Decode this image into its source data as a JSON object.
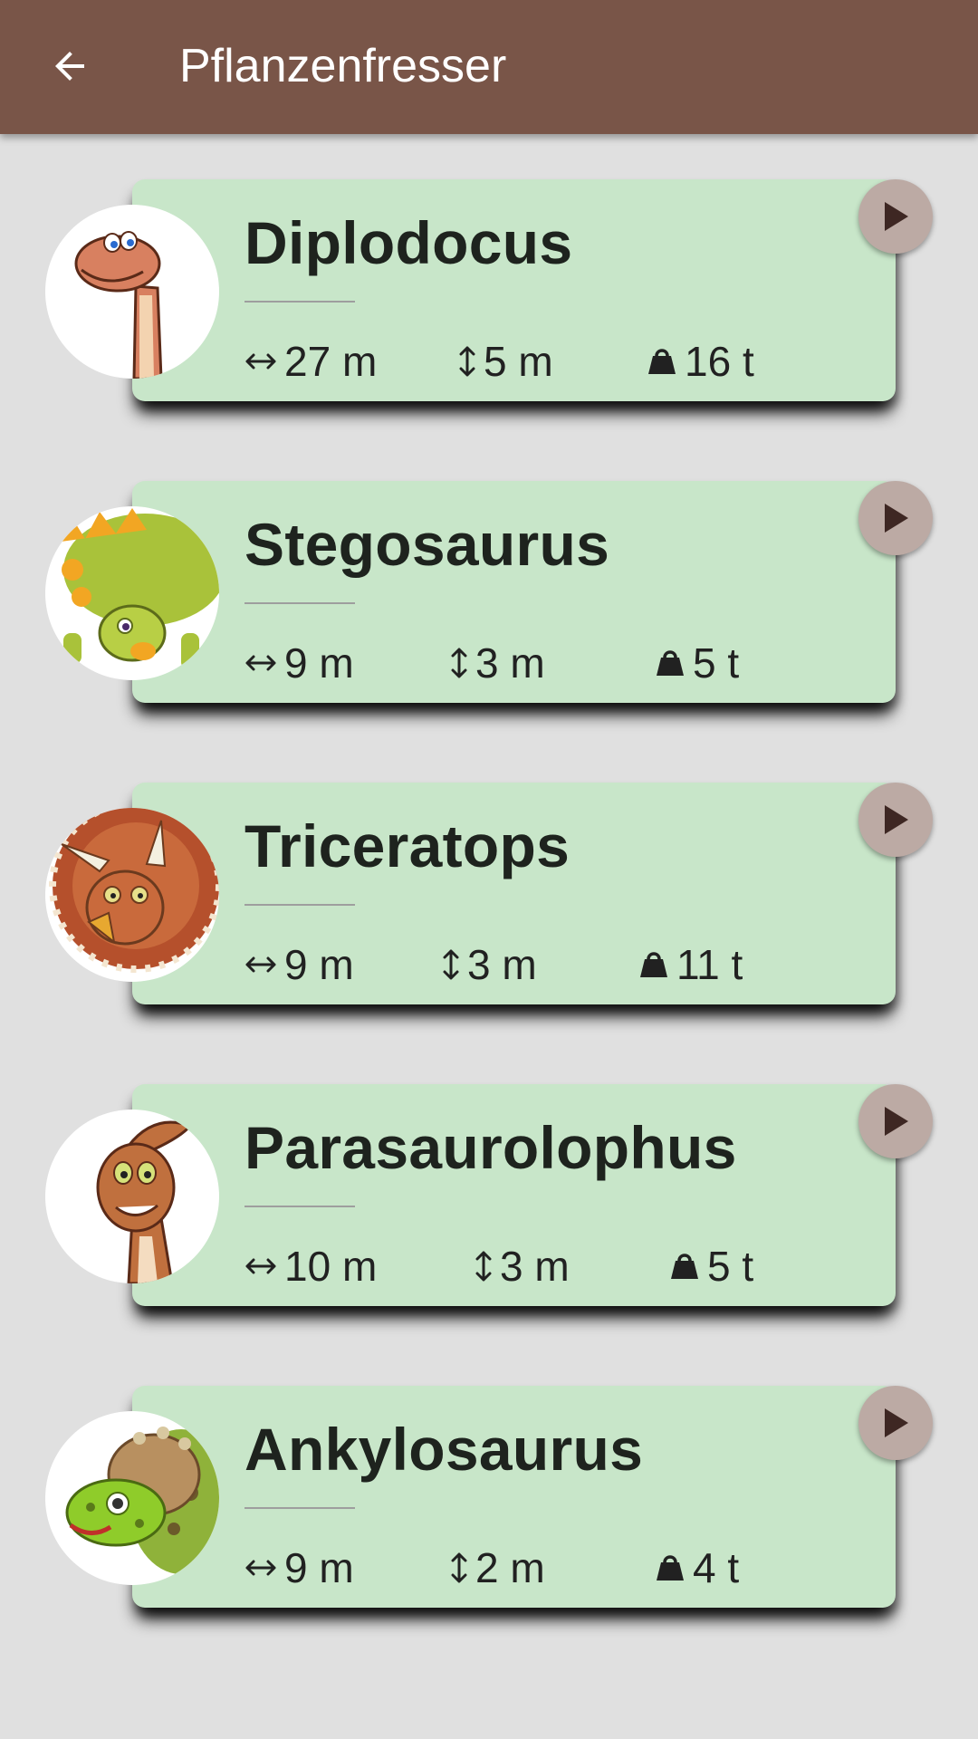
{
  "app_bar": {
    "title": "Pflanzenfresser",
    "back_icon": "arrow-back-icon",
    "background": "#795548"
  },
  "colors": {
    "card": "#c8e6c9",
    "play_button": "#bcaaa4",
    "play_icon": "#3e2723",
    "page_background": "#e0e0e0"
  },
  "icons": {
    "length": "horizontal-arrow-icon",
    "height": "vertical-arrow-icon",
    "weight": "weight-icon",
    "play": "play-icon"
  },
  "dinosaurs": [
    {
      "name": "Diplodocus",
      "length": "27 m",
      "height": "5 m",
      "weight": "16 t",
      "image": "diplodocus-image"
    },
    {
      "name": "Stegosaurus",
      "length": "9 m",
      "height": "3 m",
      "weight": "5 t",
      "image": "stegosaurus-image"
    },
    {
      "name": "Triceratops",
      "length": "9 m",
      "height": "3 m",
      "weight": "11 t",
      "image": "triceratops-image"
    },
    {
      "name": "Parasaurolophus",
      "length": "10 m",
      "height": "3 m",
      "weight": "5 t",
      "image": "parasaurolophus-image"
    },
    {
      "name": "Ankylosaurus",
      "length": "9 m",
      "height": "2 m",
      "weight": "4 t",
      "image": "ankylosaurus-image"
    }
  ]
}
